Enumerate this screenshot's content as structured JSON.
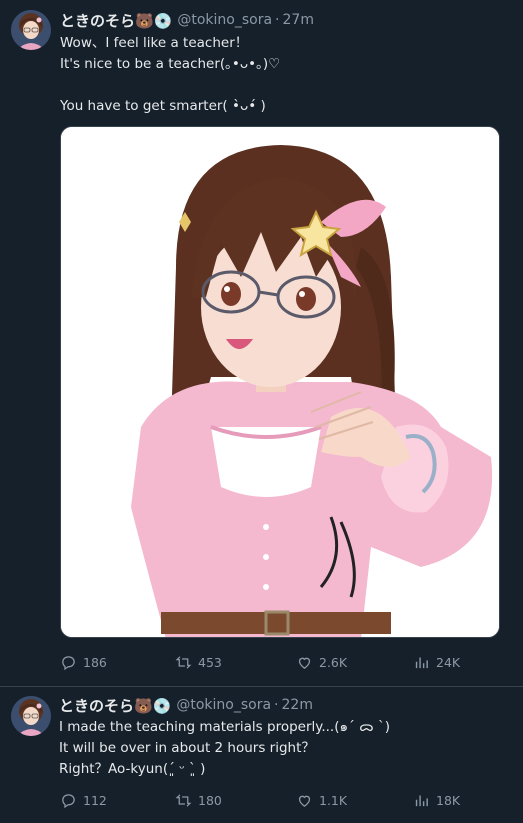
{
  "tweets": [
    {
      "name": "ときのそら🐻💿",
      "handle": "@tokino_sora",
      "separator": "·",
      "time": "27m",
      "lines": [
        "Wow、I feel like a teacher！",
        "It's nice to be a teacher(｡•ᴗ•｡)♡",
        "",
        "You have to get smarter( •̀ᴗ•́ )"
      ],
      "replies": "186",
      "retweets": "453",
      "likes": "2.6K",
      "views": "24K"
    },
    {
      "name": "ときのそら🐻💿",
      "handle": "@tokino_sora",
      "separator": "·",
      "time": "22m",
      "lines": [
        "I made the teaching materials properly...(๑ˊ ᯅ ˋ)",
        "It will be over in about 2 hours right？",
        "Right？Ao-kyun(´͈ ᵕ `͈ )"
      ],
      "replies": "112",
      "retweets": "180",
      "likes": "1.1K",
      "views": "18K"
    }
  ],
  "colors": {
    "background": "#15202b",
    "text": "#e7e9ea",
    "muted": "#8b98a5",
    "divider": "#38444d"
  },
  "icons": [
    "avatar",
    "bear-emoji-icon",
    "disc-emoji-icon",
    "reply-icon",
    "retweet-icon",
    "like-icon",
    "views-icon"
  ]
}
